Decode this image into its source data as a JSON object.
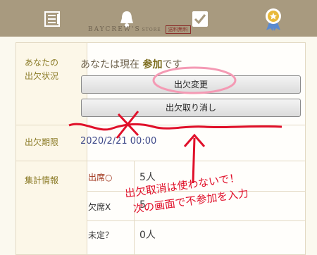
{
  "header": {
    "brand": "BAYCREW'S",
    "brand_suffix": "STORE",
    "free_badge": "送料無料",
    "icons": [
      "list-icon",
      "bell-icon",
      "checkbox-icon",
      "badge-icon"
    ]
  },
  "attendance": {
    "label": "あなたの\n出欠状況",
    "status_prefix": "あなたは現在 ",
    "status_value": "参加",
    "status_suffix": "です",
    "change_button": "出欠変更",
    "cancel_button": "出欠取り消し"
  },
  "deadline": {
    "label": "出欠期限",
    "value": "2020/2/21 00:00"
  },
  "summary": {
    "label": "集計情報",
    "rows": [
      {
        "label": "出席○",
        "value": "5人",
        "color": "#a0361c"
      },
      {
        "label": "欠席X",
        "value": "5",
        "color": "#2a2a2a"
      },
      {
        "label": "未定？",
        "value": "0人",
        "color": "#3a3a3a"
      }
    ]
  },
  "annotation": {
    "line1": "出欠取消は使わないで！",
    "line2": "次の画面で不参加を入力",
    "color": "#e0102a",
    "circle_color": "#f49ab4"
  },
  "colors": {
    "topbar": "#a89a7f",
    "label_text": "#8a7a25",
    "date_text": "#3f4a8a"
  }
}
